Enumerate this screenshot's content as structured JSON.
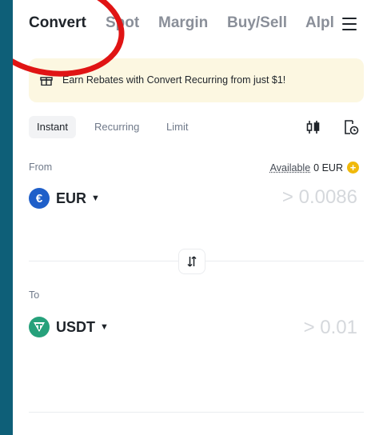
{
  "nav": {
    "tabs": [
      "Convert",
      "Spot",
      "Margin",
      "Buy/Sell",
      "Alpl"
    ],
    "active": "Convert"
  },
  "promo": {
    "text": "Earn Rebates with Convert Recurring from just $1!"
  },
  "modes": [
    "Instant",
    "Recurring",
    "Limit"
  ],
  "from": {
    "label": "From",
    "available_label": "Available",
    "available_value": "0 EUR",
    "coin": "EUR",
    "amount_placeholder": "> 0.0086",
    "coin_color": "#1f5fc9"
  },
  "to": {
    "label": "To",
    "coin": "USDT",
    "amount_placeholder": "> 0.01",
    "coin_color": "#26a17b"
  },
  "colors": {
    "accent": "#f0b90b",
    "annotation": "#e01414"
  }
}
